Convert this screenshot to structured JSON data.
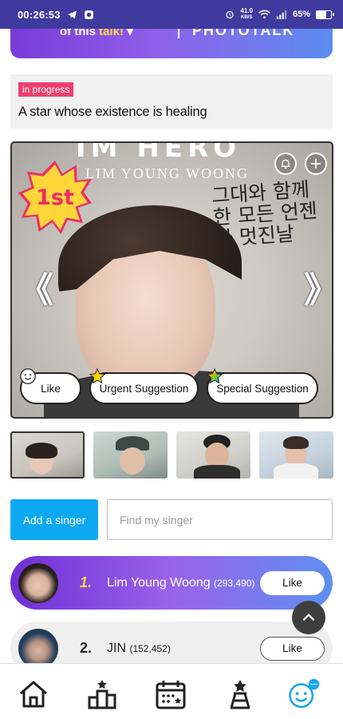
{
  "status_bar": {
    "time": "00:26:53",
    "net_speed_value": "41.0",
    "net_speed_unit": "KB/S",
    "battery": "65%",
    "battery_level": 0.65
  },
  "banner": {
    "line1_prefix": "of this",
    "line1_highlight": "talk!",
    "line2": "PHOTOTALK"
  },
  "talk": {
    "badge": "in progress",
    "title": "A star whose existence is healing"
  },
  "hero": {
    "overlay_title": "IM HERO",
    "overlay_subtitle": "LIM YOUNG WOONG",
    "korean_text": "그대와 함께한 모든 언젠가 멋진날",
    "rank_badge": "1st",
    "prev_arrow": "《",
    "next_arrow": "》",
    "buttons": {
      "like": "Like",
      "urgent": "Urgent Suggestion",
      "special": "Special Suggestion"
    }
  },
  "thumbnails": [
    {
      "label": "thumbnail-1",
      "selected": true
    },
    {
      "label": "thumbnail-2",
      "selected": false
    },
    {
      "label": "thumbnail-3",
      "selected": false
    },
    {
      "label": "thumbnail-4",
      "selected": false
    }
  ],
  "search": {
    "add_button": "Add a singer",
    "placeholder": "Find my singer"
  },
  "ranking": [
    {
      "rank": "1.",
      "name": "Lim Young Woong",
      "votes": "(293,490)",
      "like": "Like"
    },
    {
      "rank": "2.",
      "name": "JIN",
      "votes": "(152,452)",
      "like": "Like"
    }
  ],
  "colors": {
    "accent_blue": "#0ea8f0",
    "badge_pink": "#ee3e6f",
    "rank_gold": "#ffd64a",
    "status_bar": "#3f3a9e"
  },
  "bottom_nav": [
    "home-icon",
    "ranking-icon",
    "calendar-icon",
    "hall-of-fame-icon",
    "chat-smile-icon"
  ]
}
